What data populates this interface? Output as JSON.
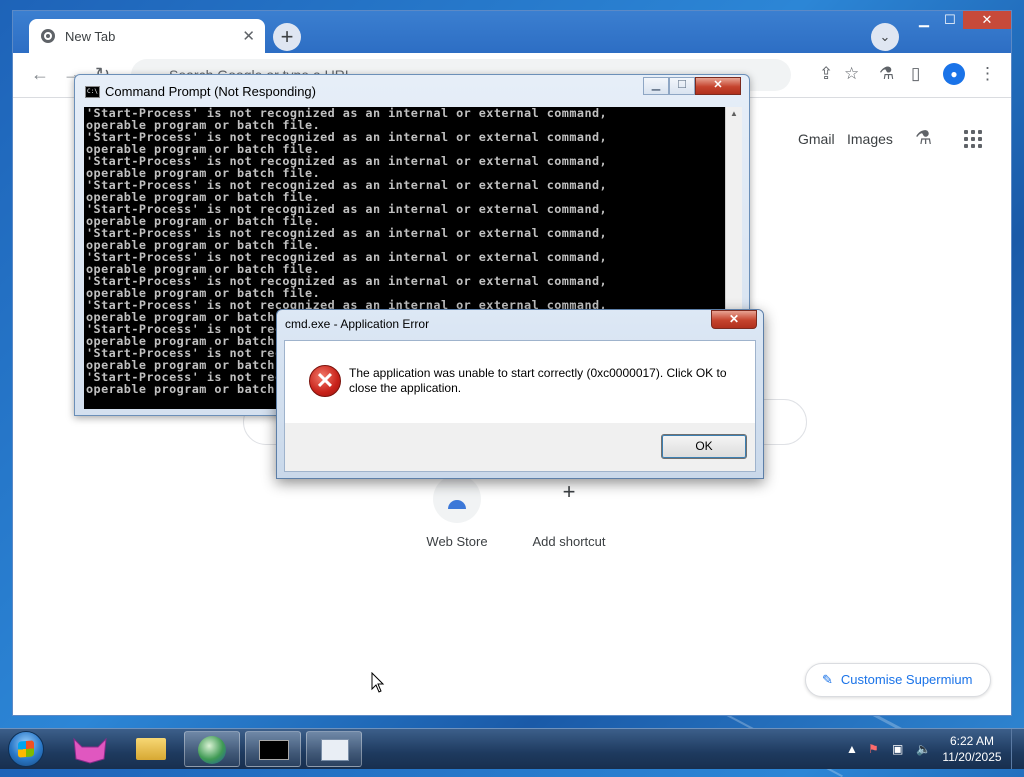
{
  "browser": {
    "tab_title": "New Tab",
    "tab_close": "✕",
    "new_tab": "+",
    "tab_search": "⌄",
    "window_controls": {
      "minimize": "▁",
      "maximize": "☐",
      "close": "✕"
    },
    "omnibox_placeholder": "Search Google or type a URL",
    "ntp_links": {
      "gmail": "Gmail",
      "images": "Images"
    },
    "shortcuts": [
      {
        "label": "Web Store"
      },
      {
        "label": "Add shortcut",
        "icon": "+"
      }
    ],
    "customise_label": "Customise Supermium"
  },
  "cmd_window": {
    "title": "Command Prompt (Not Responding)",
    "lines": [
      "'Start-Process' is not recognized as an internal or external command,",
      "operable program or batch file.",
      "'Start-Process' is not recognized as an internal or external command,",
      "operable program or batch file.",
      "'Start-Process' is not recognized as an internal or external command,",
      "operable program or batch file.",
      "'Start-Process' is not recognized as an internal or external command,",
      "operable program or batch file.",
      "'Start-Process' is not recognized as an internal or external command,",
      "operable program or batch file.",
      "'Start-Process' is not recognized as an internal or external command,",
      "operable program or batch file.",
      "'Start-Process' is not recognized as an internal or external command,",
      "operable program or batch file.",
      "'Start-Process' is not recognized as an internal or external command,",
      "operable program or batch file.",
      "'Start-Process' is not recognized as an internal or external command,",
      "operable program or batch file.",
      "'Start-Process' is not recognized as an internal or external command,",
      "operable program or batch file.",
      "'Start-Process' is not recognized as an internal or external command,",
      "operable program or batch file.",
      "'Start-Process' is not recognized as an internal or external command,",
      "operable program or batch file."
    ],
    "close": "✕"
  },
  "error_dialog": {
    "title": "cmd.exe - Application Error",
    "message": "The application was unable to start correctly (0xc0000017). Click OK to close the application.",
    "ok_label": "OK",
    "close": "✕",
    "icon_glyph": "✕"
  },
  "taskbar": {
    "time": "6:22 AM",
    "date": "11/20/2025"
  },
  "colors": {
    "accent": "#1a73e8",
    "error_red": "#c8221a",
    "taskbar": "#1e3a5f"
  }
}
